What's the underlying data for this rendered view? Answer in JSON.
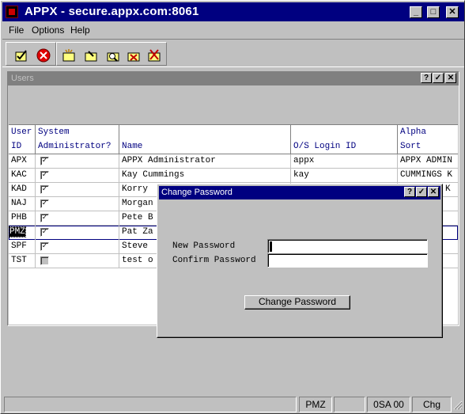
{
  "window": {
    "title": "APPX - secure.appx.com:8061",
    "buttons": {
      "minimize": "_",
      "maximize": "□",
      "close": "✕"
    }
  },
  "menu": [
    "File",
    "Options",
    "Help"
  ],
  "toolbar": {
    "icons": [
      "ok-icon",
      "cancel-icon",
      "add-icon",
      "change-icon",
      "inquire-icon",
      "delete-icon",
      "delete-all-icon"
    ]
  },
  "users_window": {
    "title": "Users",
    "buttons": {
      "help": "?",
      "ok": "✓",
      "close": "✕"
    },
    "columns": [
      {
        "line1": "User",
        "line2": "ID"
      },
      {
        "line1": "System",
        "line2": "Administrator?"
      },
      {
        "line1": "",
        "line2": "Name"
      },
      {
        "line1": "",
        "line2": "O/S Login ID"
      },
      {
        "line1": "Alpha",
        "line2": "Sort"
      }
    ],
    "rows": [
      {
        "id": "APX",
        "admin": true,
        "name": "APPX Administrator",
        "login": "appx",
        "sort": "APPX ADMIN"
      },
      {
        "id": "KAC",
        "admin": true,
        "name": "Kay Cummings",
        "login": "kay",
        "sort": "CUMMINGS K"
      },
      {
        "id": "KAD",
        "admin": true,
        "name": "Korry",
        "login": "",
        "sort": "K"
      },
      {
        "id": "NAJ",
        "admin": true,
        "name": "Morgan",
        "login": "",
        "sort": ""
      },
      {
        "id": "PHB",
        "admin": true,
        "name": "Pete B",
        "login": "",
        "sort": ""
      },
      {
        "id": "PMZ",
        "admin": true,
        "name": "Pat Za",
        "login": "",
        "sort": ""
      },
      {
        "id": "SPF",
        "admin": true,
        "name": "Steve",
        "login": "",
        "sort": ""
      },
      {
        "id": "TST",
        "admin": false,
        "name": "test o",
        "login": "",
        "sort": ""
      }
    ]
  },
  "dialog": {
    "title": "Change Password",
    "buttons": {
      "help": "?",
      "ok": "✓",
      "close": "✕"
    },
    "new_password_label": "New Password",
    "confirm_password_label": "Confirm Password",
    "new_password_value": "",
    "confirm_password_value": "",
    "submit_label": "Change Password"
  },
  "statusbar": {
    "user": "PMZ",
    "database": "0SA 00",
    "mode": "Chg"
  },
  "colors": {
    "title_active": "#000080",
    "title_inactive": "#808080",
    "face": "#c0c0c0",
    "header_text": "#000080"
  }
}
